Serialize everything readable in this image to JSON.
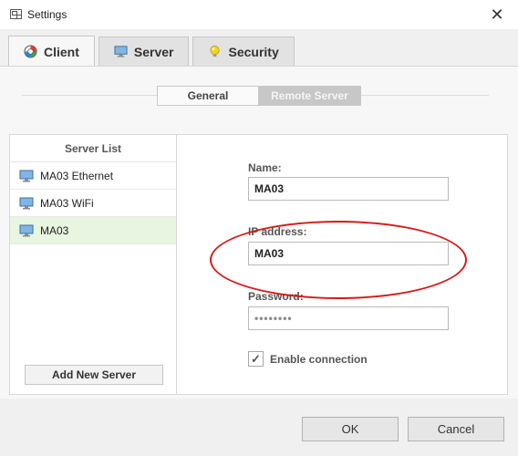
{
  "window": {
    "title": "Settings",
    "close_glyph": "✕"
  },
  "tabs": [
    {
      "label": "Client",
      "icon": "client-icon",
      "active": true
    },
    {
      "label": "Server",
      "icon": "monitor-icon",
      "active": false
    },
    {
      "label": "Security",
      "icon": "lightbulb-icon",
      "active": false
    }
  ],
  "subtabs": {
    "general": "General",
    "remote": "Remote Server",
    "active": "Remote Server"
  },
  "server_list": {
    "title": "Server List",
    "items": [
      {
        "label": "MA03 Ethernet",
        "selected": false
      },
      {
        "label": "MA03 WiFi",
        "selected": false
      },
      {
        "label": "MA03",
        "selected": true
      }
    ],
    "add_button": "Add New Server"
  },
  "form": {
    "name_label": "Name:",
    "name_value": "MA03",
    "ip_label": "IP address:",
    "ip_value": "MA03",
    "password_label": "Password:",
    "password_value": "••••••••",
    "enable_label": "Enable connection",
    "enable_checked": true,
    "check_glyph": "✓"
  },
  "footer": {
    "ok": "OK",
    "cancel": "Cancel"
  },
  "colors": {
    "selected_row": "#e8f5e0",
    "annotation": "#d61a1a",
    "active_subtab": "#c7c7c7"
  }
}
